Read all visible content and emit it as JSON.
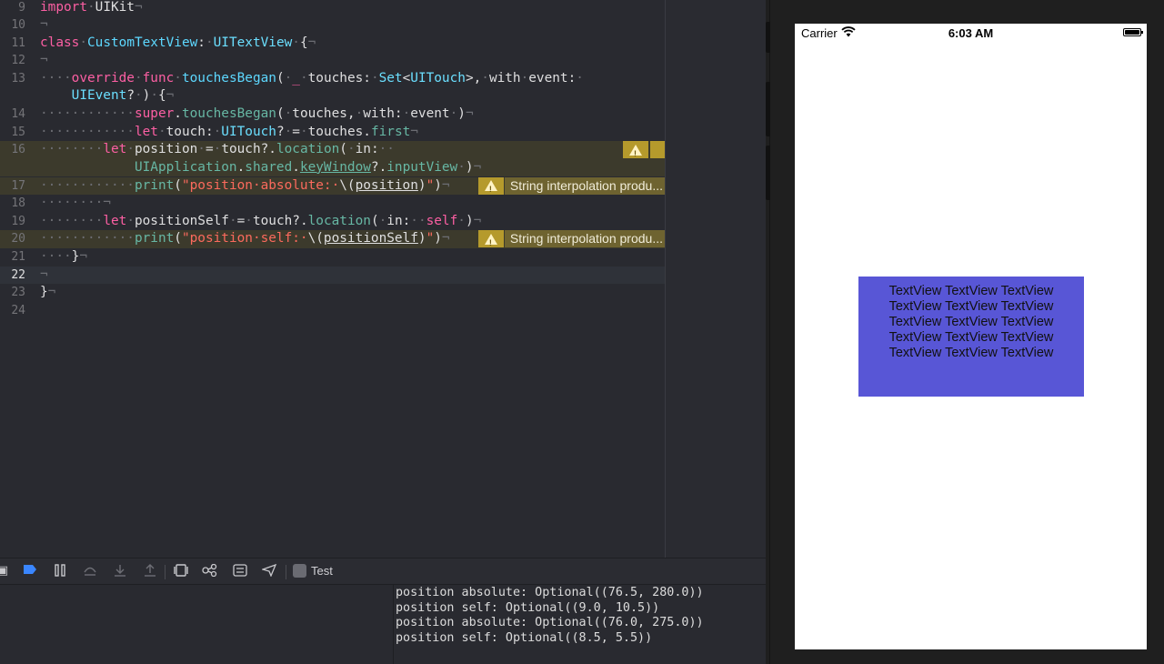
{
  "editor": {
    "lines": [
      {
        "n": "9",
        "parts": [
          [
            "kw",
            "import"
          ],
          [
            "ws",
            "·"
          ],
          [
            "pl",
            "UIKit"
          ],
          [
            "ws",
            "¬"
          ]
        ]
      },
      {
        "n": "10",
        "parts": [
          [
            "ws",
            "¬"
          ]
        ]
      },
      {
        "n": "11",
        "parts": [
          [
            "kw",
            "class"
          ],
          [
            "ws",
            "·"
          ],
          [
            "ty",
            "CustomTextView"
          ],
          [
            "pl",
            ":"
          ],
          [
            "ws",
            "·"
          ],
          [
            "ty2",
            "UITextView"
          ],
          [
            "ws",
            "·"
          ],
          [
            "pl",
            "{"
          ],
          [
            "ws",
            "¬"
          ]
        ]
      },
      {
        "n": "12",
        "parts": [
          [
            "ws",
            "¬"
          ]
        ]
      },
      {
        "n": "13",
        "parts": [
          [
            "ws",
            "····"
          ],
          [
            "kw",
            "override"
          ],
          [
            "ws",
            "·"
          ],
          [
            "kw",
            "func"
          ],
          [
            "ws",
            "·"
          ],
          [
            "ty",
            "touchesBegan"
          ],
          [
            "pl",
            "("
          ],
          [
            "ws",
            "·"
          ],
          [
            "kw",
            "_"
          ],
          [
            "ws",
            "·"
          ],
          [
            "pl",
            "touches:"
          ],
          [
            "ws",
            "·"
          ],
          [
            "ty2",
            "Set"
          ],
          [
            "pl",
            "<"
          ],
          [
            "ty2",
            "UITouch"
          ],
          [
            "pl",
            ">,"
          ],
          [
            "ws",
            "·"
          ],
          [
            "pl",
            "with"
          ],
          [
            "ws",
            "·"
          ],
          [
            "pl",
            "event:"
          ],
          [
            "ws",
            "·"
          ]
        ],
        "cont": [
          [
            "ws",
            "    "
          ],
          [
            "ty2",
            "UIEvent"
          ],
          [
            "pl",
            "?"
          ],
          [
            "ws",
            "·"
          ],
          [
            "pl",
            ")"
          ],
          [
            "ws",
            "·"
          ],
          [
            "pl",
            "{"
          ],
          [
            "ws",
            "¬"
          ]
        ]
      },
      {
        "n": "14",
        "parts": [
          [
            "ws",
            "············"
          ],
          [
            "kw",
            "super"
          ],
          [
            "pl",
            "."
          ],
          [
            "mt",
            "touchesBegan"
          ],
          [
            "pl",
            "("
          ],
          [
            "ws",
            "·"
          ],
          [
            "pl",
            "touches,"
          ],
          [
            "ws",
            "·"
          ],
          [
            "pl",
            "with:"
          ],
          [
            "ws",
            "·"
          ],
          [
            "pl",
            "event"
          ],
          [
            "ws",
            "·"
          ],
          [
            "pl",
            ")"
          ],
          [
            "ws",
            "¬"
          ]
        ]
      },
      {
        "n": "15",
        "parts": [
          [
            "ws",
            "············"
          ],
          [
            "kw",
            "let"
          ],
          [
            "ws",
            "·"
          ],
          [
            "pl",
            "touch:"
          ],
          [
            "ws",
            "·"
          ],
          [
            "ty2",
            "UITouch"
          ],
          [
            "pl",
            "?"
          ],
          [
            "ws",
            "·"
          ],
          [
            "pl",
            "="
          ],
          [
            "ws",
            "·"
          ],
          [
            "pl",
            "touches."
          ],
          [
            "mt",
            "first"
          ],
          [
            "ws",
            "¬"
          ]
        ]
      },
      {
        "n": "16",
        "parts": [
          [
            "ws",
            "········"
          ],
          [
            "kw",
            "let"
          ],
          [
            "ws",
            "·"
          ],
          [
            "pl",
            "position"
          ],
          [
            "ws",
            "·"
          ],
          [
            "pl",
            "="
          ],
          [
            "ws",
            "·"
          ],
          [
            "pl",
            "touch?."
          ],
          [
            "mt",
            "location"
          ],
          [
            "pl",
            "("
          ],
          [
            "ws",
            "·"
          ],
          [
            "pl",
            "in:"
          ],
          [
            "ws",
            "··"
          ]
        ],
        "cont": [
          [
            "ws",
            "            "
          ],
          [
            "mt",
            "UIApplication"
          ],
          [
            "pl",
            "."
          ],
          [
            "mt",
            "shared"
          ],
          [
            "pl",
            "."
          ],
          [
            "mt",
            "keyWindow"
          ],
          [
            "pl",
            "?."
          ],
          [
            "mt",
            "inputView"
          ],
          [
            "ws",
            "·"
          ],
          [
            "pl",
            ")"
          ],
          [
            "ws",
            "¬"
          ]
        ]
      },
      {
        "n": "17",
        "parts": [
          [
            "ws",
            "············"
          ],
          [
            "mt",
            "print"
          ],
          [
            "pl",
            "("
          ],
          [
            "st",
            "\"position·absolute:·"
          ],
          [
            "pl",
            "\\("
          ],
          [
            "pl",
            "position"
          ],
          [
            "pl",
            ")"
          ],
          [
            "st",
            "\""
          ],
          [
            "pl",
            ")"
          ],
          [
            "ws",
            "¬"
          ]
        ]
      },
      {
        "n": "18",
        "parts": [
          [
            "ws",
            "········¬"
          ]
        ]
      },
      {
        "n": "19",
        "parts": [
          [
            "ws",
            "········"
          ],
          [
            "kw",
            "let"
          ],
          [
            "ws",
            "·"
          ],
          [
            "pl",
            "positionSelf"
          ],
          [
            "ws",
            "·"
          ],
          [
            "pl",
            "="
          ],
          [
            "ws",
            "·"
          ],
          [
            "pl",
            "touch?."
          ],
          [
            "mt",
            "location"
          ],
          [
            "pl",
            "("
          ],
          [
            "ws",
            "·"
          ],
          [
            "pl",
            "in:"
          ],
          [
            "ws",
            "··"
          ],
          [
            "kw",
            "self"
          ],
          [
            "ws",
            "·"
          ],
          [
            "pl",
            ")"
          ],
          [
            "ws",
            "¬"
          ]
        ]
      },
      {
        "n": "20",
        "parts": [
          [
            "ws",
            "············"
          ],
          [
            "mt",
            "print"
          ],
          [
            "pl",
            "("
          ],
          [
            "st",
            "\"position·self:·"
          ],
          [
            "pl",
            "\\("
          ],
          [
            "pl",
            "positionSelf"
          ],
          [
            "pl",
            ")"
          ],
          [
            "st",
            "\""
          ],
          [
            "pl",
            ")"
          ],
          [
            "ws",
            "¬"
          ]
        ]
      },
      {
        "n": "21",
        "parts": [
          [
            "ws",
            "····"
          ],
          [
            "pl",
            "}"
          ],
          [
            "ws",
            "¬"
          ]
        ]
      },
      {
        "n": "22",
        "parts": [
          [
            "ws",
            "¬"
          ]
        ]
      },
      {
        "n": "23",
        "parts": [
          [
            "pl",
            "}"
          ],
          [
            "ws",
            "¬"
          ]
        ]
      },
      {
        "n": "24",
        "parts": []
      }
    ],
    "warning_text": "String interpolation produ...",
    "current_line": "22"
  },
  "toolbar": {
    "target_label": "Test"
  },
  "console": {
    "lines": [
      "position absolute: Optional((76.5, 280.0))",
      "position self: Optional((9.0, 10.5))",
      "position absolute: Optional((76.0, 275.0))",
      "position self: Optional((8.5, 5.5))"
    ]
  },
  "simulator": {
    "carrier": "Carrier",
    "time": "6:03 AM",
    "textview_lines": [
      "TextView TextView TextView",
      "TextView TextView TextView",
      "TextView TextView TextView",
      "TextView TextView TextView",
      "TextView TextView TextView"
    ],
    "textview_color": "#5856d6"
  }
}
